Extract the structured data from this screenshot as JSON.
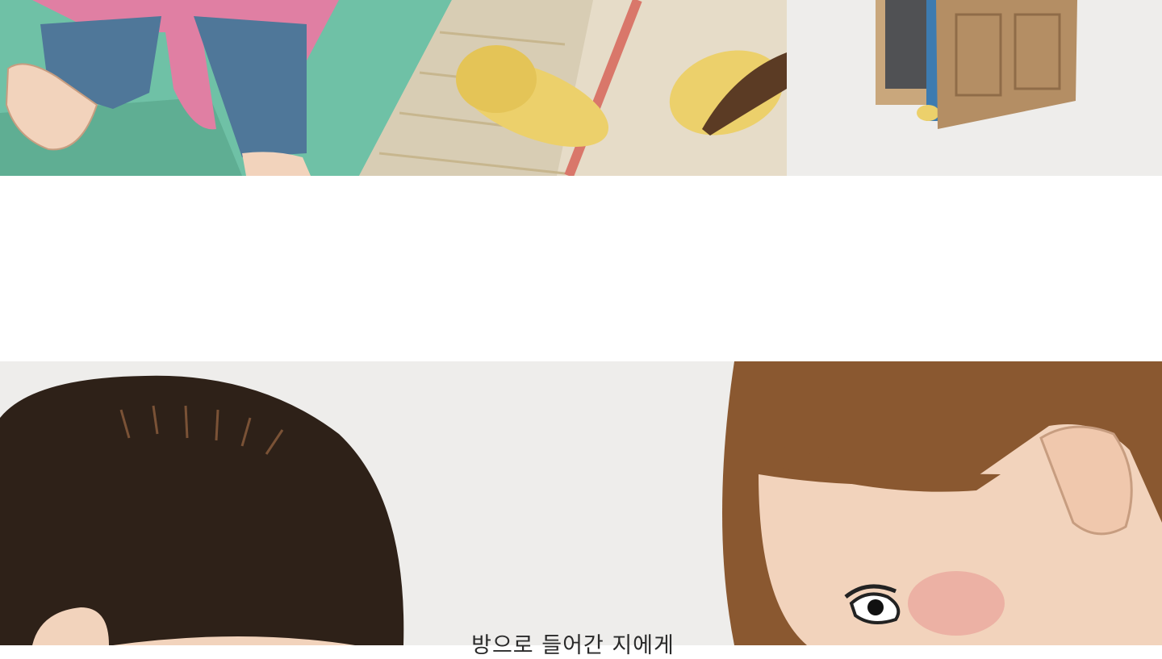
{
  "story": {
    "caption": "방으로 들어간 지에게"
  },
  "colors": {
    "floor_green": "#6fc1a6",
    "floor_wood": "#e6dcc8",
    "slipper_yellow": "#ecd06b",
    "stripe_red": "#d9776a",
    "door_brown": "#b48e64",
    "paper_gray": "#eeedeb",
    "hair_dark": "#2e2118",
    "hair_brown": "#8a5830",
    "skin": "#f2d3bc",
    "pajama_pink": "#e07fa3",
    "pants_blue": "#4f7799"
  }
}
